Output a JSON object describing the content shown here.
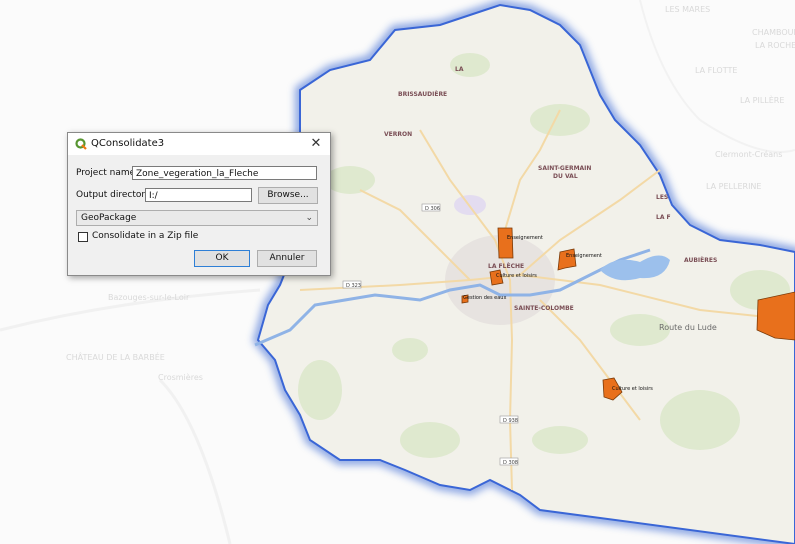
{
  "dialog": {
    "title": "QConsolidate3",
    "close_glyph": "✕",
    "project_name_label": "Project name",
    "project_name_value": "Zone_vegeration_la_Fleche",
    "output_dir_label": "Output directory",
    "output_dir_value": "I:/",
    "browse_label": "Browse...",
    "format_value": "GeoPackage",
    "zip_label": "Consolidate in a Zip file",
    "zip_checked": false,
    "ok_label": "OK",
    "cancel_label": "Annuler"
  },
  "map": {
    "place_labels": [
      "VERRON",
      "SAINT-GERMAIN",
      "DU VAL",
      "SAINTE-COLOMBE",
      "LA FLÈCHE",
      "BRISSAUDIÈRE",
      "LA",
      "LES",
      "LA F",
      "AUBIÈRES"
    ],
    "road_labels": [
      "D 306",
      "D 323",
      "D 938",
      "D 308",
      "Route du Lude"
    ],
    "zone_labels": [
      "Enseignement",
      "Enseignement",
      "Culture et loisirs",
      "Gestion des eaux",
      "Culture et loisirs"
    ],
    "faded_labels": [
      "Bazouges-sur-le-Loir",
      "Clermont-Créans",
      "LA PELLERINE",
      "CHÂTEAU DE LA BARBÉE",
      "Crosmières",
      "LES MARES",
      "LA ROCHE",
      "CHAMBOURDE",
      "LA FLOTTE",
      "LA PILLÈRE"
    ],
    "zone_color": "#e8701c",
    "boundary_color": "#2f5fcf",
    "river_color": "#8fb3e6"
  }
}
